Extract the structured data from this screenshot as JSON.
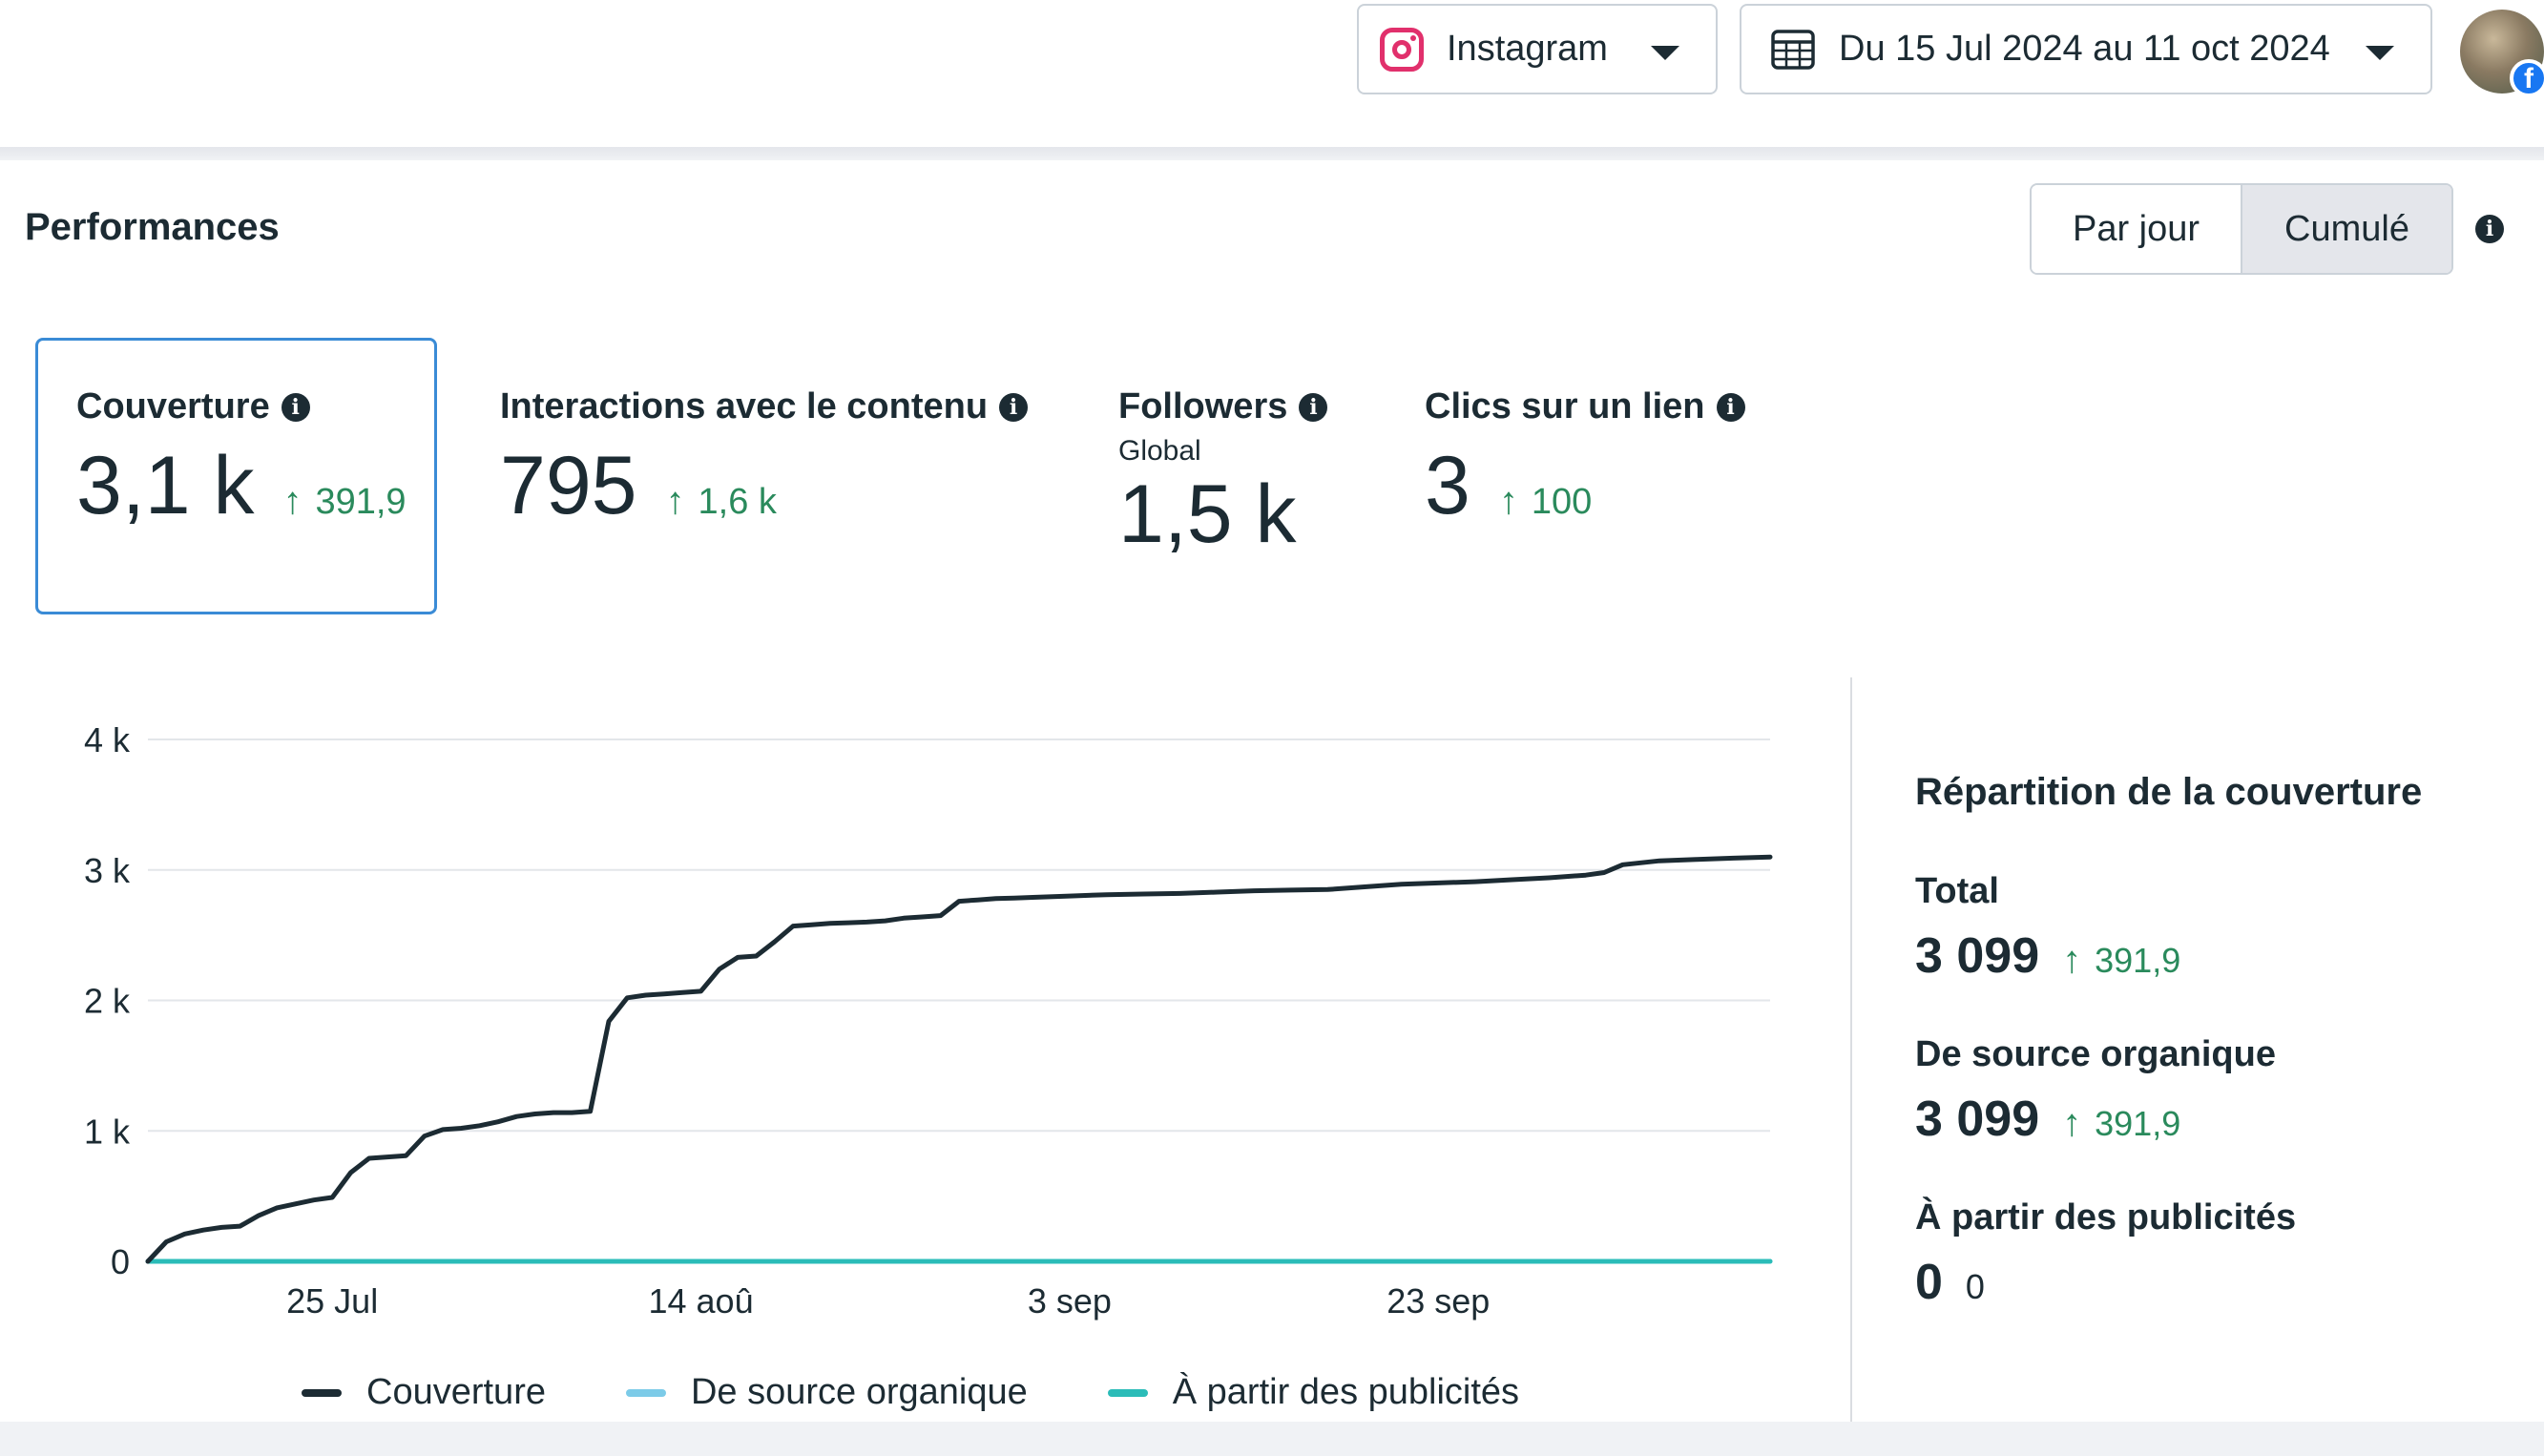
{
  "toolbar": {
    "platform": "Instagram",
    "date_range": "Du 15 Jul 2024 au 11 oct 2024",
    "platform_icon": "instagram-icon",
    "date_icon": "calendar-icon"
  },
  "section": {
    "title": "Performances",
    "toggle": [
      "Par jour",
      "Cumulé"
    ],
    "toggle_active": "Cumulé"
  },
  "metrics": [
    {
      "title": "Couverture",
      "value": "3,1 k",
      "delta": "391,9",
      "selected": true
    },
    {
      "title": "Interactions avec le contenu",
      "value": "795",
      "delta": "1,6 k"
    },
    {
      "title": "Followers",
      "subtitle": "Global",
      "value": "1,5 k"
    },
    {
      "title": "Clics sur un lien",
      "value": "3",
      "delta": "100"
    }
  ],
  "breakdown": {
    "title": "Répartition de la couverture",
    "items": [
      {
        "label": "Total",
        "value": "3 099",
        "delta": "391,9"
      },
      {
        "label": "De source organique",
        "value": "3 099",
        "delta": "391,9"
      },
      {
        "label": "À partir des publicités",
        "value": "0",
        "delta": "0"
      }
    ]
  },
  "colors": {
    "couverture": "#1c2b33",
    "organique": "#7ccbe8",
    "publicites": "#2bbcb8",
    "delta_green": "#2a8a5c",
    "selected_border": "#3a8bd6"
  },
  "chart_data": {
    "type": "line",
    "y_ticks": [
      {
        "value": 0,
        "label": "0"
      },
      {
        "value": 1000,
        "label": "1 k"
      },
      {
        "value": 2000,
        "label": "2 k"
      },
      {
        "value": 3000,
        "label": "3 k"
      },
      {
        "value": 4000,
        "label": "4 k"
      }
    ],
    "ylim": [
      0,
      4000
    ],
    "x_range": [
      "2024-07-15",
      "2024-10-11"
    ],
    "x_ticks": [
      {
        "date": "2024-07-25",
        "label": "25 Jul"
      },
      {
        "date": "2024-08-14",
        "label": "14 aoû"
      },
      {
        "date": "2024-09-03",
        "label": "3 sep"
      },
      {
        "date": "2024-09-23",
        "label": "23 sep"
      }
    ],
    "grid": true,
    "legend_position": "bottom",
    "series": [
      {
        "name": "Couverture",
        "x": [
          "2024-07-15",
          "2024-07-16",
          "2024-07-17",
          "2024-07-18",
          "2024-07-19",
          "2024-07-20",
          "2024-07-21",
          "2024-07-22",
          "2024-07-23",
          "2024-07-24",
          "2024-07-25",
          "2024-07-26",
          "2024-07-27",
          "2024-07-28",
          "2024-07-29",
          "2024-07-30",
          "2024-07-31",
          "2024-08-01",
          "2024-08-02",
          "2024-08-03",
          "2024-08-04",
          "2024-08-05",
          "2024-08-06",
          "2024-08-07",
          "2024-08-08",
          "2024-08-09",
          "2024-08-10",
          "2024-08-11",
          "2024-08-12",
          "2024-08-13",
          "2024-08-14",
          "2024-08-15",
          "2024-08-16",
          "2024-08-17",
          "2024-08-18",
          "2024-08-19",
          "2024-08-20",
          "2024-08-21",
          "2024-08-22",
          "2024-08-23",
          "2024-08-24",
          "2024-08-25",
          "2024-08-26",
          "2024-08-27",
          "2024-08-28",
          "2024-08-29",
          "2024-08-30",
          "2024-08-31",
          "2024-09-01",
          "2024-09-03",
          "2024-09-05",
          "2024-09-07",
          "2024-09-09",
          "2024-09-11",
          "2024-09-13",
          "2024-09-15",
          "2024-09-17",
          "2024-09-19",
          "2024-09-21",
          "2024-09-23",
          "2024-09-25",
          "2024-09-27",
          "2024-09-29",
          "2024-10-01",
          "2024-10-02",
          "2024-10-03",
          "2024-10-05",
          "2024-10-07",
          "2024-10-09",
          "2024-10-11"
        ],
        "y": [
          0,
          150,
          210,
          240,
          260,
          270,
          350,
          410,
          440,
          470,
          490,
          680,
          790,
          800,
          810,
          960,
          1010,
          1020,
          1040,
          1070,
          1110,
          1130,
          1140,
          1140,
          1150,
          1840,
          2020,
          2040,
          2050,
          2060,
          2070,
          2240,
          2330,
          2340,
          2450,
          2570,
          2580,
          2590,
          2595,
          2600,
          2610,
          2630,
          2640,
          2650,
          2760,
          2770,
          2780,
          2785,
          2790,
          2800,
          2810,
          2815,
          2820,
          2830,
          2840,
          2845,
          2850,
          2870,
          2890,
          2900,
          2910,
          2925,
          2940,
          2960,
          2980,
          3040,
          3070,
          3080,
          3090,
          3099
        ]
      },
      {
        "name": "De source organique",
        "x": [
          "2024-07-15",
          "2024-10-11"
        ],
        "y": [
          0,
          0
        ]
      },
      {
        "name": "À partir des publicités",
        "x": [
          "2024-07-15",
          "2024-10-11"
        ],
        "y": [
          0,
          0
        ]
      }
    ]
  }
}
